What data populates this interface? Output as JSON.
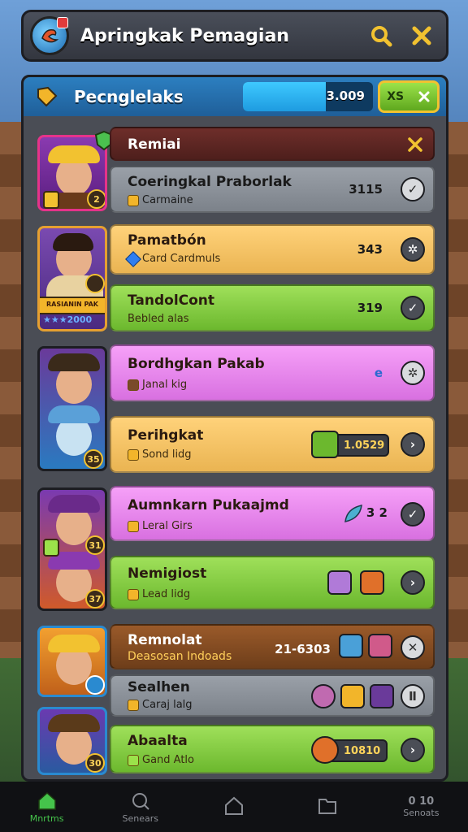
{
  "header": {
    "title": "Apringkak Pemagian"
  },
  "panel": {
    "title": "Pecnglelaks",
    "progress_text": "3.009",
    "progress_fraction": 0.64,
    "xs_label": "XS"
  },
  "rows": [
    {
      "name": "Remiai",
      "sub": "",
      "value": "",
      "color": "dark",
      "action": "close"
    },
    {
      "name": "Coeringkal Praborlak",
      "sub": "Carmaine",
      "value": "3115",
      "color": "gray",
      "action": "check"
    },
    {
      "name": "Pamatbón",
      "sub": "Card Cardmuls",
      "value": "343",
      "color": "orange",
      "action": "settings"
    },
    {
      "name": "TandolCont",
      "sub": "Bebled alas",
      "value": "319",
      "color": "green",
      "action": "check"
    },
    {
      "name": "Bordhgkan Pakab",
      "sub": "Janal kig",
      "value": "e",
      "color": "pink",
      "action": "settings"
    },
    {
      "name": "Perihgkat",
      "sub": "Sond lidg",
      "value": "1.0529",
      "color": "orange",
      "action": "next"
    },
    {
      "name": "Aumnkarn Pukaajmd",
      "sub": "Leral Girs",
      "value": "3 2",
      "color": "pink",
      "action": "check"
    },
    {
      "name": "Nemigiost",
      "sub": "Lead lidg",
      "value": "",
      "color": "green",
      "action": "next"
    },
    {
      "name": "Remnolat",
      "sub": "Deasosan Indoads",
      "value": "21-6303",
      "color": "brown",
      "action": "close"
    },
    {
      "name": "Sealhen",
      "sub": "Caraj lalg",
      "value": "",
      "color": "gray",
      "action": "pause"
    },
    {
      "name": "Abaalta",
      "sub": "Gand Atlo",
      "value": "10810",
      "color": "green",
      "action": "next"
    }
  ],
  "portraits": {
    "p1_level": "2",
    "p2_tag": "RASIANIN PAK",
    "p2_stars": "★★★2000",
    "p3_level": "35",
    "p4_level_a": "31",
    "p4_level_b": "37",
    "p5_level": "",
    "p6_level": "30"
  },
  "nav": [
    {
      "label": "Mnrtms",
      "icon": "home-icon",
      "active": true
    },
    {
      "label": "Senears",
      "icon": "search-icon",
      "active": false
    },
    {
      "label": "",
      "icon": "house-icon",
      "active": false
    },
    {
      "label": "",
      "icon": "book-icon",
      "active": false
    },
    {
      "label": "Senoats",
      "icon": "stats-icon",
      "active": false
    }
  ],
  "nav_extra": {
    "stats_value": "0 10"
  },
  "colors": {
    "accent_green": "#45c44b",
    "progress_blue": "#1e9be0",
    "gold": "#f2c230"
  }
}
